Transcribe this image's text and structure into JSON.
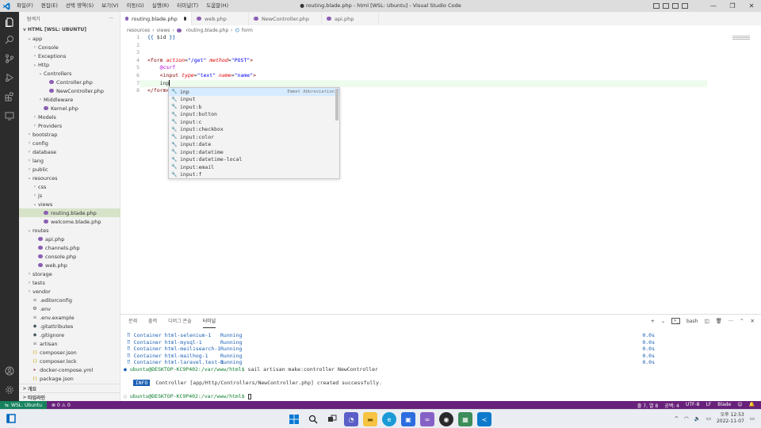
{
  "titlebar": {
    "menu": [
      "파일(F)",
      "편집(E)",
      "선택 영역(S)",
      "보기(V)",
      "이동(G)",
      "실행(R)",
      "터미널(T)",
      "도움말(H)"
    ],
    "title": "● routing.blade.php - html [WSL: Ubuntu] - Visual Studio Code"
  },
  "sidebar": {
    "header": "탐색기",
    "more": "···",
    "section": "HTML [WSL: UBUNTU]",
    "tree": [
      {
        "label": "app",
        "indent": 1,
        "chev": "v",
        "icon": ""
      },
      {
        "label": "Console",
        "indent": 2,
        "chev": ">",
        "icon": ""
      },
      {
        "label": "Exceptions",
        "indent": 2,
        "chev": ">",
        "icon": ""
      },
      {
        "label": "Http",
        "indent": 2,
        "chev": "v",
        "icon": ""
      },
      {
        "label": "Controllers",
        "indent": 3,
        "chev": "v",
        "icon": ""
      },
      {
        "label": "Controller.php",
        "indent": 4,
        "chev": "",
        "icon": "php"
      },
      {
        "label": "NewController.php",
        "indent": 4,
        "chev": "",
        "icon": "php"
      },
      {
        "label": "Middleware",
        "indent": 3,
        "chev": ">",
        "icon": ""
      },
      {
        "label": "Kernel.php",
        "indent": 3,
        "chev": "",
        "icon": "php"
      },
      {
        "label": "Models",
        "indent": 2,
        "chev": ">",
        "icon": ""
      },
      {
        "label": "Providers",
        "indent": 2,
        "chev": ">",
        "icon": ""
      },
      {
        "label": "bootstrap",
        "indent": 1,
        "chev": ">",
        "icon": ""
      },
      {
        "label": "config",
        "indent": 1,
        "chev": ">",
        "icon": ""
      },
      {
        "label": "database",
        "indent": 1,
        "chev": ">",
        "icon": ""
      },
      {
        "label": "lang",
        "indent": 1,
        "chev": ">",
        "icon": ""
      },
      {
        "label": "public",
        "indent": 1,
        "chev": ">",
        "icon": ""
      },
      {
        "label": "resources",
        "indent": 1,
        "chev": "v",
        "icon": ""
      },
      {
        "label": "css",
        "indent": 2,
        "chev": ">",
        "icon": ""
      },
      {
        "label": "js",
        "indent": 2,
        "chev": ">",
        "icon": ""
      },
      {
        "label": "views",
        "indent": 2,
        "chev": "v",
        "icon": ""
      },
      {
        "label": "routing.blade.php",
        "indent": 3,
        "chev": "",
        "icon": "php",
        "selected": true
      },
      {
        "label": "welcome.blade.php",
        "indent": 3,
        "chev": "",
        "icon": "php"
      },
      {
        "label": "routes",
        "indent": 1,
        "chev": "v",
        "icon": ""
      },
      {
        "label": "api.php",
        "indent": 2,
        "chev": "",
        "icon": "php"
      },
      {
        "label": "channels.php",
        "indent": 2,
        "chev": "",
        "icon": "php"
      },
      {
        "label": "console.php",
        "indent": 2,
        "chev": "",
        "icon": "php"
      },
      {
        "label": "web.php",
        "indent": 2,
        "chev": "",
        "icon": "php"
      },
      {
        "label": "storage",
        "indent": 1,
        "chev": ">",
        "icon": ""
      },
      {
        "label": "tests",
        "indent": 1,
        "chev": ">",
        "icon": ""
      },
      {
        "label": "vendor",
        "indent": 1,
        "chev": ">",
        "icon": ""
      },
      {
        "label": ".editorconfig",
        "indent": 1,
        "chev": "",
        "icon": "text"
      },
      {
        "label": ".env",
        "indent": 1,
        "chev": "",
        "icon": "gear"
      },
      {
        "label": ".env.example",
        "indent": 1,
        "chev": "",
        "icon": "text"
      },
      {
        "label": ".gitattributes",
        "indent": 1,
        "chev": "",
        "icon": "git"
      },
      {
        "label": ".gitignore",
        "indent": 1,
        "chev": "",
        "icon": "git"
      },
      {
        "label": "artisan",
        "indent": 1,
        "chev": "",
        "icon": "text"
      },
      {
        "label": "composer.json",
        "indent": 1,
        "chev": "",
        "icon": "json"
      },
      {
        "label": "composer.lock",
        "indent": 1,
        "chev": "",
        "icon": "json"
      },
      {
        "label": "docker-compose.yml",
        "indent": 1,
        "chev": "",
        "icon": "yml"
      },
      {
        "label": "package.json",
        "indent": 1,
        "chev": "",
        "icon": "json"
      }
    ],
    "outline": "개요",
    "timeline": "타임라인"
  },
  "tabs": [
    {
      "label": "routing.blade.php",
      "active": true,
      "dirty": true
    },
    {
      "label": "web.php",
      "active": false
    },
    {
      "label": "NewController.php",
      "active": false
    },
    {
      "label": "api.php",
      "active": false
    }
  ],
  "breadcrumb": [
    "resources",
    "views",
    "routing.blade.php",
    "form"
  ],
  "editor": {
    "line_numbers": [
      "1",
      "2",
      "3",
      "4",
      "5",
      "6",
      "7",
      "8"
    ]
  },
  "suggest": {
    "items": [
      "inp",
      "input",
      "input:b",
      "input:button",
      "input:c",
      "input:checkbox",
      "input:color",
      "input:date",
      "input:datetime",
      "input:datetime-local",
      "input:email",
      "input:f"
    ],
    "detail": "Emmet Abbreviation"
  },
  "panel": {
    "tabs": [
      "문제",
      "출력",
      "디버그 콘솔",
      "터미널"
    ],
    "active_tab": "터미널",
    "shell": "bash",
    "containers": [
      {
        "name": " ⠿ Container html-selenium-1",
        "status": "Running",
        "time": "0.0s"
      },
      {
        "name": " ⠿ Container html-mysql-1",
        "status": "Running",
        "time": "0.0s"
      },
      {
        "name": " ⠿ Container html-meilisearch-1",
        "status": "Running",
        "time": "0.0s"
      },
      {
        "name": " ⠿ Container html-mailhog-1",
        "status": "Running",
        "time": "0.0s"
      },
      {
        "name": " ⠿ Container html-laravel.test-1",
        "status": "Running",
        "time": "0.0s"
      }
    ],
    "prompt": "ubuntu@DESKTOP-KC9P402:/var/www/html$",
    "command": " sail artisan make:controller NewController",
    "info_badge": "INFO",
    "info_text": " Controller [app/Http/Controllers/NewController.php] created successfully."
  },
  "statusbar": {
    "remote": "WSL: Ubuntu",
    "errors": "⊗ 0 ⚠ 0",
    "position": "줄 7, 열 8",
    "spaces": "공백: 4",
    "encoding": "UTF-8",
    "eol": "LF",
    "language": "Blade"
  },
  "taskbar": {
    "time": "오후 12:53",
    "date": "2022-11-07"
  },
  "colors": {
    "statusbar": "#68217a",
    "remote": "#16825d",
    "activitybar": "#2c2c2c",
    "selection": "#d6ebff"
  }
}
